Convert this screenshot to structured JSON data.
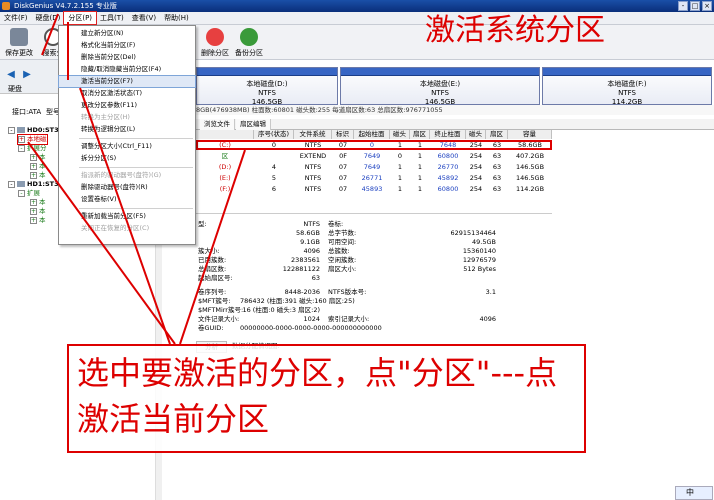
{
  "window": {
    "title": "DiskGenius V4.7.2.155 专业版",
    "buttons": [
      "-",
      "□",
      "×"
    ]
  },
  "menubar": [
    "文件(F)",
    "硬盘(D)",
    "分区(P)",
    "工具(T)",
    "查看(V)",
    "帮助(H)"
  ],
  "toolbar": {
    "save_label": "保存更改",
    "search_label": "搜索分",
    "delete_label": "删除分区",
    "backup_label": "备份分区"
  },
  "left": {
    "disk_label": "硬盘",
    "iface": "接口:ATA",
    "model": "型号"
  },
  "tree": [
    {
      "label": "HD0:ST35",
      "level": 0
    },
    {
      "label": "本地磁",
      "level": 1
    },
    {
      "label": "扩展分",
      "level": 1
    },
    {
      "label": "本",
      "level": 2
    },
    {
      "label": "本",
      "level": 2
    },
    {
      "label": "本",
      "level": 2
    },
    {
      "label": "HD1:ST31",
      "level": 0
    },
    {
      "label": "扩展",
      "level": 1
    },
    {
      "label": "本",
      "level": 2
    },
    {
      "label": "本",
      "level": 2
    },
    {
      "label": "本",
      "level": 2
    }
  ],
  "dropdown": [
    {
      "label": "建立新分区(N)",
      "state": "normal"
    },
    {
      "label": "格式化当前分区(F)",
      "state": "normal"
    },
    {
      "label": "删除当前分区(Del)",
      "state": "normal"
    },
    {
      "label": "隐藏/取消隐藏当前分区(F4)",
      "state": "normal"
    },
    {
      "label": "激活当前分区(F7)",
      "state": "highlight"
    },
    {
      "label": "取消分区激活状态(T)",
      "state": "normal"
    },
    {
      "label": "更改分区参数(F11)",
      "state": "normal"
    },
    {
      "label": "转换为主分区(H)",
      "state": "disabled"
    },
    {
      "label": "转换为逻辑分区(L)",
      "state": "normal"
    },
    {
      "label": "调整分区大小(Ctrl_F11)",
      "state": "normal"
    },
    {
      "label": "拆分分区(S)",
      "state": "normal"
    },
    {
      "label": "指派新的驱动器号(盘符)(G)",
      "state": "disabled"
    },
    {
      "label": "删除驱动器号(盘符)(R)",
      "state": "normal"
    },
    {
      "label": "设置卷标(V)",
      "state": "normal"
    },
    {
      "label": "重新加载当前分区(F5)",
      "state": "normal"
    },
    {
      "label": "关闭正在恢复的分区(C)",
      "state": "disabled"
    }
  ],
  "partitions_strip": [
    {
      "name": "本地磁盘(D:)",
      "fs": "NTFS",
      "size": "146.5GB"
    },
    {
      "name": "本地磁盘(E:)",
      "fs": "NTFS",
      "size": "146.5GB"
    },
    {
      "name": "本地磁盘(F:)",
      "fs": "NTFS",
      "size": "114.2GB"
    }
  ],
  "infoline": "8GB(476938MB) 柱面数:60801 磁头数:255 每道扇区数:63 总扇区数:976771055",
  "tabs": [
    "浏览文件",
    "扇区编辑"
  ],
  "table": {
    "headers": [
      "",
      "序号(状态)",
      "文件系统",
      "标识",
      "起始柱面",
      "磁头",
      "扇区",
      "终止柱面",
      "磁头",
      "扇区",
      "容量"
    ],
    "rows": [
      [
        "(C:)",
        "0",
        "NTFS",
        "07",
        "0",
        "1",
        "1",
        "7648",
        "254",
        "63",
        "58.6GB"
      ],
      [
        "区",
        "",
        "EXTEND",
        "0F",
        "7649",
        "0",
        "1",
        "60800",
        "254",
        "63",
        "407.2GB"
      ],
      [
        "(D:)",
        "4",
        "NTFS",
        "07",
        "7649",
        "1",
        "1",
        "26770",
        "254",
        "63",
        "146.5GB"
      ],
      [
        "(E:)",
        "5",
        "NTFS",
        "07",
        "26771",
        "1",
        "1",
        "45892",
        "254",
        "63",
        "146.5GB"
      ],
      [
        "(F:)",
        "6",
        "NTFS",
        "07",
        "45893",
        "1",
        "1",
        "60800",
        "254",
        "63",
        "114.2GB"
      ]
    ]
  },
  "props": [
    {
      "k": "型:",
      "v": "NTFS",
      "k2": "卷标:",
      "v2": ""
    },
    {
      "k": "",
      "v": "58.6GB",
      "k2": "总字节数:",
      "v2": "62915134464"
    },
    {
      "k": "",
      "v": "9.1GB",
      "k2": "可用空间:",
      "v2": "49.5GB"
    },
    {
      "k": "簇大小:",
      "v": "4096",
      "k2": "总簇数:",
      "v2": "15360140"
    },
    {
      "k": "已用簇数:",
      "v": "2383561",
      "k2": "空闲簇数:",
      "v2": "12976579"
    },
    {
      "k": "总扇区数:",
      "v": "122881122",
      "k2": "扇区大小:",
      "v2": "512 Bytes"
    },
    {
      "k": "起始扇区号:",
      "v": "63",
      "k2": "",
      "v2": ""
    },
    {
      "k": "卷序列号:",
      "v": "8448-2036",
      "k2": "NTFS版本号:",
      "v2": "3.1"
    },
    {
      "k": "$MFT簇号:",
      "v": "786432 (柱面:391 磁头:160 扇区:25)",
      "k2": "",
      "v2": ""
    },
    {
      "k": "$MFTMirr簇号:",
      "v": "16 (柱面:0 磁头:3 扇区:2)",
      "k2": "",
      "v2": ""
    },
    {
      "k": "文件记录大小:",
      "v": "1024",
      "k2": "索引记录大小:",
      "v2": "4096"
    },
    {
      "k": "卷GUID:",
      "v": "00000000-0000-0000-0000-000000000000",
      "k2": "",
      "v2": ""
    }
  ],
  "bottom_tabs": [
    "分析",
    "数据分配情况图:"
  ],
  "annot": {
    "title": "激活系统分区",
    "instr1": "选中要激活的分区，点\"分区\"---点",
    "instr2": "激活当前分区",
    "accent": "#dd0000"
  },
  "status": {
    "ime": "中"
  }
}
